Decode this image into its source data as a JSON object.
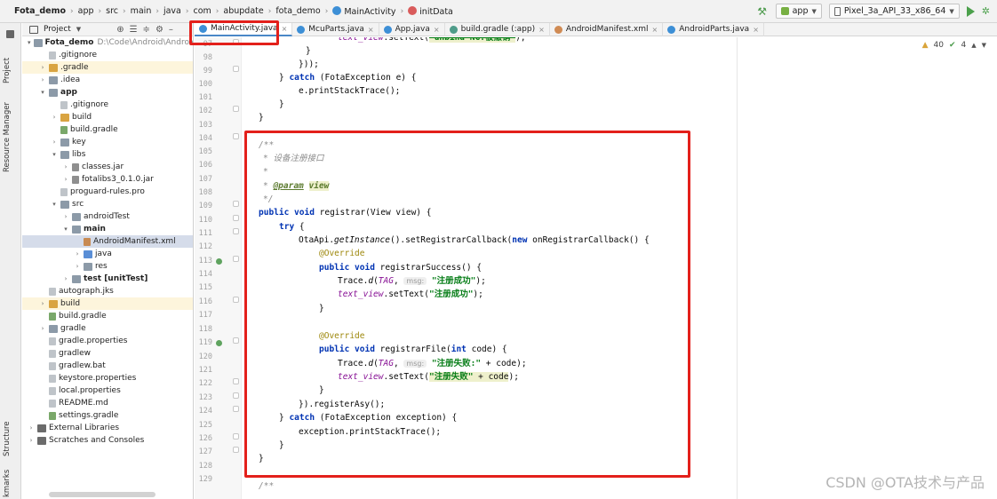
{
  "breadcrumb": {
    "items": [
      "Fota_demo",
      "app",
      "src",
      "main",
      "java",
      "com",
      "abupdate",
      "fota_demo",
      "MainActivity",
      "initData"
    ]
  },
  "toolbar": {
    "run_config": "app",
    "device": "Pixel_3a_API_33_x86_64"
  },
  "left_strip": {
    "project": "Project",
    "resource_manager": "Resource Manager",
    "structure": "Structure",
    "bookmarks": "kmarks"
  },
  "project_panel": {
    "title": "Project",
    "rows": [
      {
        "label": "Fota_demo",
        "extra": "D:\\Code\\Android\\Android",
        "indent": 0,
        "arrow": "▾",
        "icon": "folder",
        "bold": true
      },
      {
        "label": ".gitignore",
        "indent": 1,
        "arrow": "",
        "icon": "file"
      },
      {
        "label": ".gradle",
        "indent": 1,
        "arrow": "›",
        "icon": "folder-y",
        "hl": true
      },
      {
        "label": ".idea",
        "indent": 1,
        "arrow": "›",
        "icon": "folder"
      },
      {
        "label": "app",
        "indent": 1,
        "arrow": "▾",
        "icon": "folder",
        "bold": true
      },
      {
        "label": ".gitignore",
        "indent": 2,
        "arrow": "",
        "icon": "file"
      },
      {
        "label": "build",
        "indent": 2,
        "arrow": "›",
        "icon": "folder-y"
      },
      {
        "label": "build.gradle",
        "indent": 2,
        "arrow": "",
        "icon": "file-g"
      },
      {
        "label": "key",
        "indent": 2,
        "arrow": "›",
        "icon": "folder"
      },
      {
        "label": "libs",
        "indent": 2,
        "arrow": "▾",
        "icon": "folder"
      },
      {
        "label": "classes.jar",
        "indent": 3,
        "arrow": "›",
        "icon": "file-jar"
      },
      {
        "label": "fotalibs3_0.1.0.jar",
        "indent": 3,
        "arrow": "›",
        "icon": "file-jar"
      },
      {
        "label": "proguard-rules.pro",
        "indent": 2,
        "arrow": "",
        "icon": "file"
      },
      {
        "label": "src",
        "indent": 2,
        "arrow": "▾",
        "icon": "folder"
      },
      {
        "label": "androidTest",
        "indent": 3,
        "arrow": "›",
        "icon": "folder"
      },
      {
        "label": "main",
        "indent": 3,
        "arrow": "▾",
        "icon": "folder",
        "bold": true
      },
      {
        "label": "AndroidManifest.xml",
        "indent": 4,
        "arrow": "",
        "icon": "file-x",
        "sel": true
      },
      {
        "label": "java",
        "indent": 4,
        "arrow": "›",
        "icon": "folder-b"
      },
      {
        "label": "res",
        "indent": 4,
        "arrow": "›",
        "icon": "folder"
      },
      {
        "label": "test [unitTest]",
        "indent": 3,
        "arrow": "›",
        "icon": "folder",
        "bold": true
      },
      {
        "label": "autograph.jks",
        "indent": 1,
        "arrow": "",
        "icon": "file"
      },
      {
        "label": "build",
        "indent": 1,
        "arrow": "›",
        "icon": "folder-y",
        "hl": true
      },
      {
        "label": "build.gradle",
        "indent": 1,
        "arrow": "",
        "icon": "file-g"
      },
      {
        "label": "gradle",
        "indent": 1,
        "arrow": "›",
        "icon": "folder"
      },
      {
        "label": "gradle.properties",
        "indent": 1,
        "arrow": "",
        "icon": "file"
      },
      {
        "label": "gradlew",
        "indent": 1,
        "arrow": "",
        "icon": "file"
      },
      {
        "label": "gradlew.bat",
        "indent": 1,
        "arrow": "",
        "icon": "file"
      },
      {
        "label": "keystore.properties",
        "indent": 1,
        "arrow": "",
        "icon": "file"
      },
      {
        "label": "local.properties",
        "indent": 1,
        "arrow": "",
        "icon": "file"
      },
      {
        "label": "README.md",
        "indent": 1,
        "arrow": "",
        "icon": "file"
      },
      {
        "label": "settings.gradle",
        "indent": 1,
        "arrow": "",
        "icon": "file-g"
      },
      {
        "label": "External Libraries",
        "indent": 0,
        "arrow": "›",
        "icon": "lib"
      },
      {
        "label": "Scratches and Consoles",
        "indent": 0,
        "arrow": "›",
        "icon": "lib"
      }
    ]
  },
  "tabs": [
    {
      "label": "MainActivity.java",
      "type": "java",
      "active": true
    },
    {
      "label": "McuParts.java",
      "type": "java"
    },
    {
      "label": "App.java",
      "type": "java"
    },
    {
      "label": "build.gradle (:app)",
      "type": "gradle"
    },
    {
      "label": "AndroidManifest.xml",
      "type": "xml"
    },
    {
      "label": "AndroidParts.java",
      "type": "java"
    }
  ],
  "inspections": {
    "warnings": "40",
    "checks": "4"
  },
  "editor": {
    "line_numbers": [
      "97",
      "98",
      "99",
      "100",
      "101",
      "102",
      "103",
      "104",
      "105",
      "106",
      "107",
      "108",
      "109",
      "110",
      "111",
      "112",
      "113",
      "114",
      "115",
      "116",
      "117",
      "118",
      "119",
      "120",
      "121",
      "122",
      "123",
      "124",
      "125",
      "126",
      "127",
      "128",
      "129"
    ],
    "override_marker_lines": [
      "113",
      "119"
    ]
  },
  "watermark": "CSDN @OTA技术与产品"
}
